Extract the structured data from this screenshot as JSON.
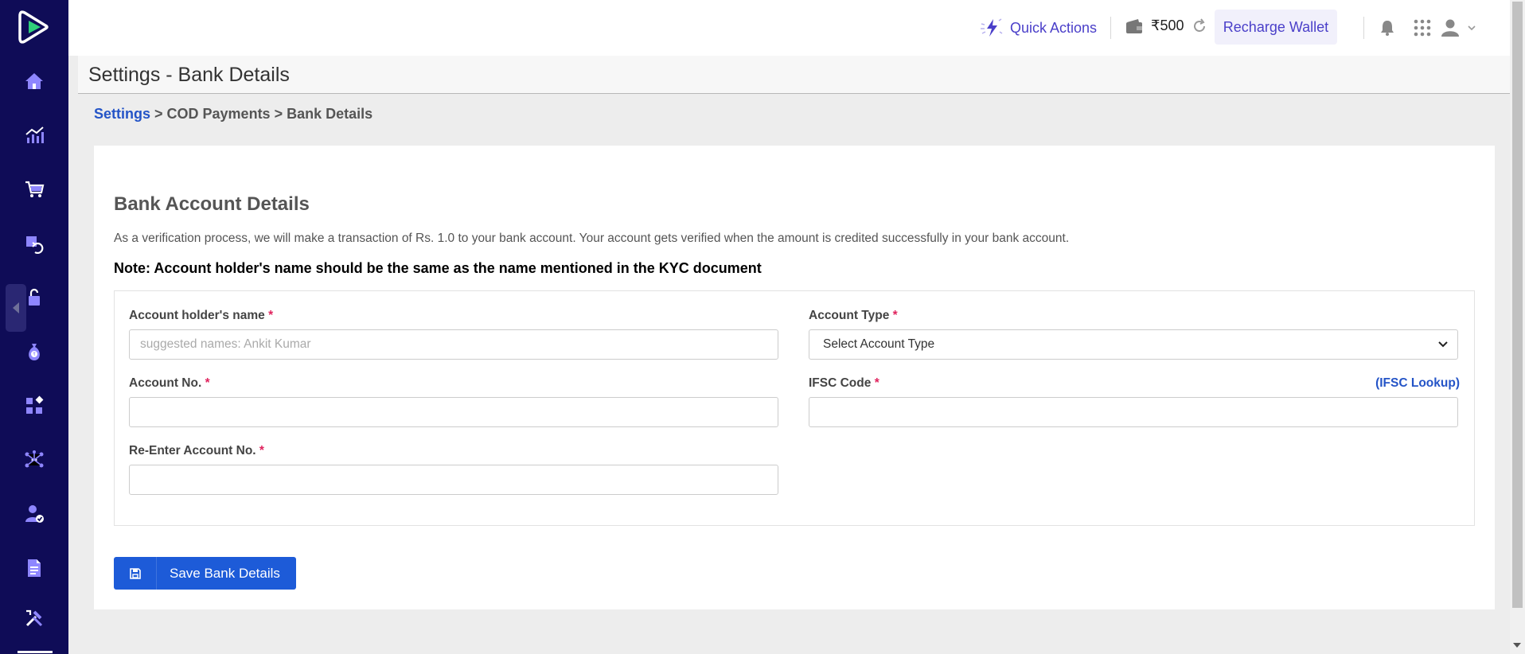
{
  "sidebar": {
    "items": [
      {
        "name": "home",
        "icon": "home-icon"
      },
      {
        "name": "analytics",
        "icon": "chart-icon"
      },
      {
        "name": "orders",
        "icon": "cart-icon"
      },
      {
        "name": "returns",
        "icon": "return-icon"
      },
      {
        "name": "billing",
        "icon": "lock-icon"
      },
      {
        "name": "cod",
        "icon": "money-bag-icon"
      },
      {
        "name": "channels",
        "icon": "apps-icon"
      },
      {
        "name": "integrations",
        "icon": "network-icon"
      },
      {
        "name": "kyc",
        "icon": "user-check-icon"
      },
      {
        "name": "reports",
        "icon": "document-icon"
      },
      {
        "name": "tools",
        "icon": "tools-icon"
      }
    ]
  },
  "topbar": {
    "quick_actions": "Quick Actions",
    "wallet_balance": "₹500",
    "recharge_label": "Recharge Wallet"
  },
  "page": {
    "title": "Settings - Bank Details"
  },
  "breadcrumb": {
    "root": "Settings",
    "rest": " > COD Payments > Bank Details"
  },
  "form": {
    "heading": "Bank Account Details",
    "description": "As a verification process, we will make a transaction of Rs. 1.0 to your bank account. Your account gets verified when the amount is credited successfully in your bank account.",
    "note": "Note: Account holder's name should be the same as the name mentioned in the KYC document",
    "holder_label": "Account holder's name",
    "holder_placeholder": "suggested names: Ankit Kumar",
    "type_label": "Account Type",
    "type_value": "Select Account Type",
    "account_no_label": "Account No.",
    "ifsc_label": "IFSC Code",
    "ifsc_lookup": "(IFSC Lookup)",
    "reenter_label": "Re-Enter Account No.",
    "required_mark": "*",
    "save_label": "Save Bank Details"
  },
  "colors": {
    "sidebar_bg": "#0f0c57",
    "accent": "#4a3fc9",
    "primary_button": "#1d5bd8",
    "link": "#2454c7",
    "required": "#e0245e"
  }
}
